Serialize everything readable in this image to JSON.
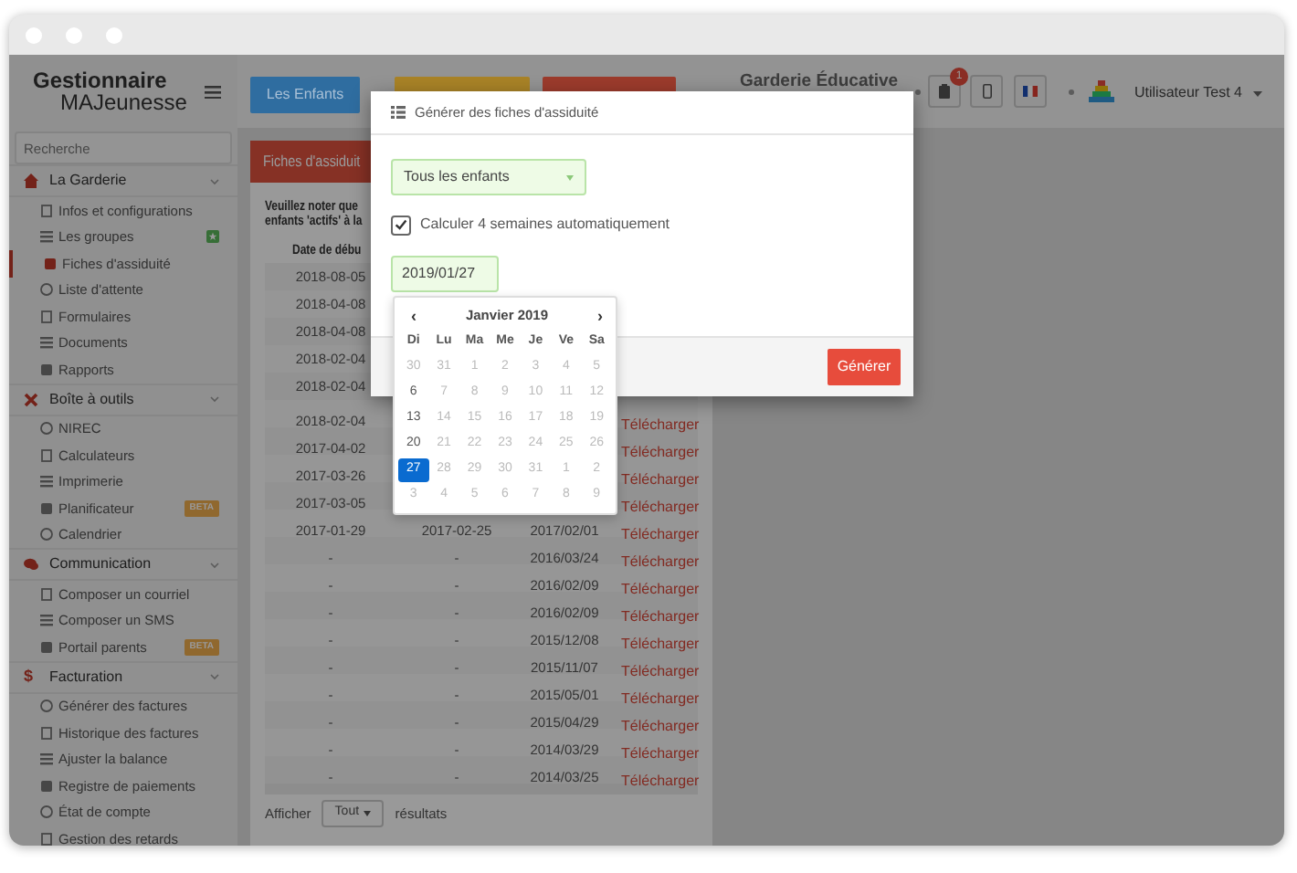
{
  "brand": {
    "line_1": "Gestionnaire",
    "line_2": "MAJeunesse"
  },
  "sidebar": {
    "search": {
      "placeholder": "Recherche"
    },
    "sections": [
      {
        "label": "La Garderie",
        "expanded": true,
        "items": [
          {
            "label": "Infos et configurations",
            "selected": false
          },
          {
            "label": "Les groupes",
            "selected": false,
            "badge": {
              "kind": "icon"
            }
          },
          {
            "label": "Fiches d'assiduité",
            "selected": true
          },
          {
            "label": "Liste d'attente",
            "selected": false
          },
          {
            "label": "Formulaires",
            "selected": false
          },
          {
            "label": "Documents",
            "selected": false
          },
          {
            "label": "Rapports",
            "selected": false
          }
        ]
      },
      {
        "label": "Boîte à outils",
        "expanded": true,
        "items": [
          {
            "label": "NIREC",
            "selected": false
          },
          {
            "label": "Calculateurs",
            "selected": false
          },
          {
            "label": "Imprimerie",
            "selected": false
          },
          {
            "label": "Planificateur",
            "selected": false,
            "badge": {
              "kind": "text",
              "text": "BETA"
            }
          },
          {
            "label": "Calendrier",
            "selected": false
          }
        ]
      },
      {
        "label": "Communication",
        "expanded": true,
        "items": [
          {
            "label": "Composer un courriel",
            "selected": false
          },
          {
            "label": "Composer un SMS",
            "selected": false
          },
          {
            "label": "Portail parents",
            "selected": false,
            "badge": {
              "kind": "text",
              "text": "BETA"
            }
          }
        ]
      },
      {
        "label": "Facturation",
        "icon_text": "$",
        "expanded": true,
        "items": [
          {
            "label": "Générer des factures",
            "selected": false
          },
          {
            "label": "Historique des factures",
            "selected": false
          },
          {
            "label": "Ajuster la balance",
            "selected": false
          },
          {
            "label": "Registre de paiements",
            "selected": false
          },
          {
            "label": "État de compte",
            "selected": false
          },
          {
            "label": "Gestion des retards",
            "selected": false
          }
        ]
      }
    ]
  },
  "topbar": {
    "nav_buttons": [
      {
        "label": "Les Enfants",
        "color": "#2f6da0"
      },
      {
        "color": "#a98327"
      },
      {
        "color": "#9c3b2c"
      }
    ],
    "daycare": "Garderie Éducative",
    "notification_count": "1",
    "user": "Utilisateur Test 4"
  },
  "panel": {
    "title": "Fiches d'assiduit",
    "notice": [
      "Veuillez noter que",
      "enfants 'actifs' à la"
    ],
    "table": {
      "columns": [
        "Date de débu"
      ],
      "rows": [
        {
          "start": "2018-08-05"
        },
        {
          "start": "2018-04-08"
        },
        {
          "start": "2018-04-08"
        },
        {
          "start": "2018-02-04"
        },
        {
          "start": "2018-02-04"
        },
        {
          "start": "2018-02-04",
          "download": "Télécharger"
        },
        {
          "start": "2017-04-02",
          "download": "Télécharger"
        },
        {
          "start": "2017-03-26",
          "download": "Télécharger"
        },
        {
          "start": "2017-03-05",
          "download": "Télécharger"
        },
        {
          "start": "2017-01-29",
          "end": "2017-02-25",
          "date": "2017/02/01",
          "download": "Télécharger"
        },
        {
          "start": "-",
          "end": "-",
          "date": "2016/03/24",
          "download": "Télécharger"
        },
        {
          "start": "-",
          "end": "-",
          "date": "2016/02/09",
          "download": "Télécharger"
        },
        {
          "start": "-",
          "end": "-",
          "date": "2016/02/09",
          "download": "Télécharger"
        },
        {
          "start": "-",
          "end": "-",
          "date": "2015/12/08",
          "download": "Télécharger"
        },
        {
          "start": "-",
          "end": "-",
          "date": "2015/11/07",
          "download": "Télécharger"
        },
        {
          "start": "-",
          "end": "-",
          "date": "2015/05/01",
          "download": "Télécharger"
        },
        {
          "start": "-",
          "end": "-",
          "date": "2015/04/29",
          "download": "Télécharger"
        },
        {
          "start": "-",
          "end": "-",
          "date": "2014/03/29",
          "download": "Télécharger"
        },
        {
          "start": "-",
          "end": "-",
          "date": "2014/03/25",
          "download": "Télécharger"
        }
      ]
    },
    "footer": {
      "show_label": "Afficher",
      "page_size": "Tout",
      "results_label": "résultats"
    }
  },
  "modal": {
    "title": "Générer des fiches d'assiduité",
    "child_select": "Tous les enfants",
    "auto_weeks": {
      "label": "Calculer 4 semaines automatiquement",
      "checked": true
    },
    "date": "2019/01/27",
    "submit": "Générer",
    "datepicker": {
      "prev": "‹",
      "month": "Janvier 2019",
      "next": "›",
      "weekdays": [
        "Di",
        "Lu",
        "Ma",
        "Me",
        "Je",
        "Ve",
        "Sa"
      ],
      "weeks": [
        [
          {
            "day": "30",
            "disabled": true,
            "selected": false
          },
          {
            "day": "31",
            "disabled": true,
            "selected": false
          },
          {
            "day": "1",
            "disabled": true,
            "selected": false
          },
          {
            "day": "2",
            "disabled": true,
            "selected": false
          },
          {
            "day": "3",
            "disabled": true,
            "selected": false
          },
          {
            "day": "4",
            "disabled": true,
            "selected": false
          },
          {
            "day": "5",
            "disabled": true,
            "selected": false
          }
        ],
        [
          {
            "day": "6",
            "disabled": false,
            "selected": false
          },
          {
            "day": "7",
            "disabled": true,
            "selected": false
          },
          {
            "day": "8",
            "disabled": true,
            "selected": false
          },
          {
            "day": "9",
            "disabled": true,
            "selected": false
          },
          {
            "day": "10",
            "disabled": true,
            "selected": false
          },
          {
            "day": "11",
            "disabled": true,
            "selected": false
          },
          {
            "day": "12",
            "disabled": true,
            "selected": false
          }
        ],
        [
          {
            "day": "13",
            "disabled": false,
            "selected": false
          },
          {
            "day": "14",
            "disabled": true,
            "selected": false
          },
          {
            "day": "15",
            "disabled": true,
            "selected": false
          },
          {
            "day": "16",
            "disabled": true,
            "selected": false
          },
          {
            "day": "17",
            "disabled": true,
            "selected": false
          },
          {
            "day": "18",
            "disabled": true,
            "selected": false
          },
          {
            "day": "19",
            "disabled": true,
            "selected": false
          }
        ],
        [
          {
            "day": "20",
            "disabled": false,
            "selected": false
          },
          {
            "day": "21",
            "disabled": true,
            "selected": false
          },
          {
            "day": "22",
            "disabled": true,
            "selected": false
          },
          {
            "day": "23",
            "disabled": true,
            "selected": false
          },
          {
            "day": "24",
            "disabled": true,
            "selected": false
          },
          {
            "day": "25",
            "disabled": true,
            "selected": false
          },
          {
            "day": "26",
            "disabled": true,
            "selected": false
          }
        ],
        [
          {
            "day": "27",
            "disabled": false,
            "selected": true
          },
          {
            "day": "28",
            "disabled": true,
            "selected": false
          },
          {
            "day": "29",
            "disabled": true,
            "selected": false
          },
          {
            "day": "30",
            "disabled": true,
            "selected": false
          },
          {
            "day": "31",
            "disabled": true,
            "selected": false
          },
          {
            "day": "1",
            "disabled": true,
            "selected": false
          },
          {
            "day": "2",
            "disabled": true,
            "selected": false
          }
        ],
        [
          {
            "day": "3",
            "disabled": true,
            "selected": false
          },
          {
            "day": "4",
            "disabled": true,
            "selected": false
          },
          {
            "day": "5",
            "disabled": true,
            "selected": false
          },
          {
            "day": "6",
            "disabled": true,
            "selected": false
          },
          {
            "day": "7",
            "disabled": true,
            "selected": false
          },
          {
            "day": "8",
            "disabled": true,
            "selected": false
          },
          {
            "day": "9",
            "disabled": true,
            "selected": false
          }
        ]
      ]
    }
  }
}
